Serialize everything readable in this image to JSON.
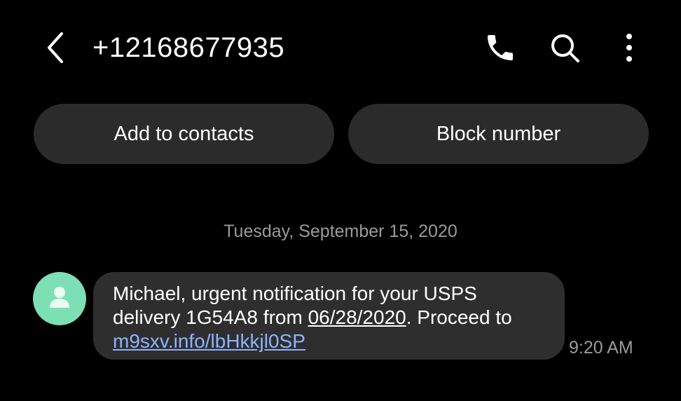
{
  "header": {
    "title": "+12168677935",
    "icons": [
      "back-arrow-icon",
      "phone-icon",
      "search-icon",
      "more-vertical-icon"
    ]
  },
  "actions": {
    "add_contacts": "Add to contacts",
    "block_number": "Block number"
  },
  "conversation": {
    "date": "Tuesday, September 15, 2020",
    "messages": [
      {
        "avatar_icon": "person-icon",
        "text_before_date": "Michael, urgent notification for your USPS delivery 1G54A8 from ",
        "date_link": "06/28/2020",
        "text_after_date": ". Proceed to ",
        "url_link": "m9sxv.info/lbHkkjl0SP",
        "time": "9:20 AM"
      }
    ]
  },
  "colors": {
    "background": "#000000",
    "button_bg": "#2b2b2b",
    "bubble_bg": "#2e2e2e",
    "avatar_bg": "#7ddfb4",
    "link": "#8fb3ff",
    "muted_text": "#9a9a9a"
  }
}
